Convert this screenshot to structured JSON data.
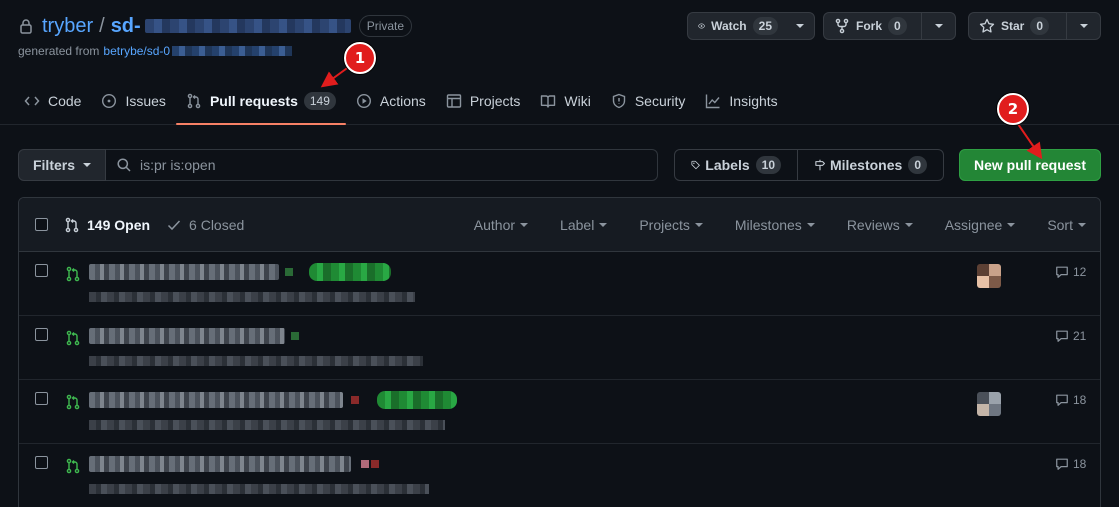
{
  "repo": {
    "owner": "tryber",
    "slash": "/",
    "name": "sd-",
    "visibility": "Private",
    "generated_prefix": "generated from",
    "generated_link": "betrybe/sd-0"
  },
  "actions": {
    "watch_label": "Watch",
    "watch_count": "25",
    "fork_label": "Fork",
    "fork_count": "0",
    "star_label": "Star",
    "star_count": "0"
  },
  "tabs": [
    {
      "label": "Code",
      "icon": "code-icon"
    },
    {
      "label": "Issues",
      "icon": "issue-icon"
    },
    {
      "label": "Pull requests",
      "icon": "pull-request-icon",
      "count": "149",
      "active": true
    },
    {
      "label": "Actions",
      "icon": "play-icon"
    },
    {
      "label": "Projects",
      "icon": "table-icon"
    },
    {
      "label": "Wiki",
      "icon": "book-icon"
    },
    {
      "label": "Security",
      "icon": "shield-icon"
    },
    {
      "label": "Insights",
      "icon": "graph-icon"
    }
  ],
  "annotations": {
    "marker1": "1",
    "marker2": "2",
    "color": "#e11d1d"
  },
  "filters": {
    "button_label": "Filters",
    "search_value": "is:pr is:open",
    "labels_label": "Labels",
    "labels_count": "10",
    "milestones_label": "Milestones",
    "milestones_count": "0",
    "new_pr_label": "New pull request"
  },
  "list": {
    "open_label": "149 Open",
    "closed_label": "6 Closed",
    "sorts": [
      "Author",
      "Label",
      "Projects",
      "Milestones",
      "Reviews",
      "Assignee",
      "Sort"
    ],
    "rows": [
      {
        "comments": "12"
      },
      {
        "comments": "21"
      },
      {
        "comments": "18"
      },
      {
        "comments": "18"
      }
    ]
  },
  "colors": {
    "accent": "#58a6ff",
    "primary_button": "#238636",
    "tab_underline": "#f78166",
    "open_icon": "#3fb950"
  }
}
